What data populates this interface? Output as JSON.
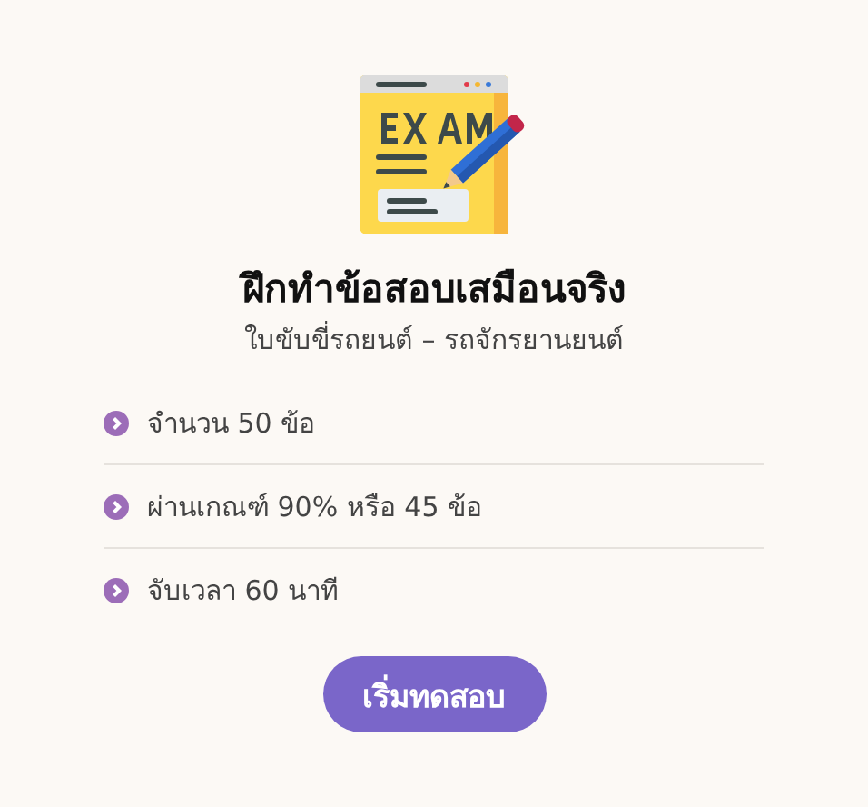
{
  "title": "ฝึกทำข้อสอบเสมือนจริง",
  "subtitle": "ใบขับขี่รถยนต์ – รถจักรยานยนต์",
  "details": [
    "จำนวน 50 ข้อ",
    "ผ่านเกณฑ์ 90% หรือ 45 ข้อ",
    "จับเวลา 60 นาที"
  ],
  "start_button": "เริ่มทดสอบ"
}
